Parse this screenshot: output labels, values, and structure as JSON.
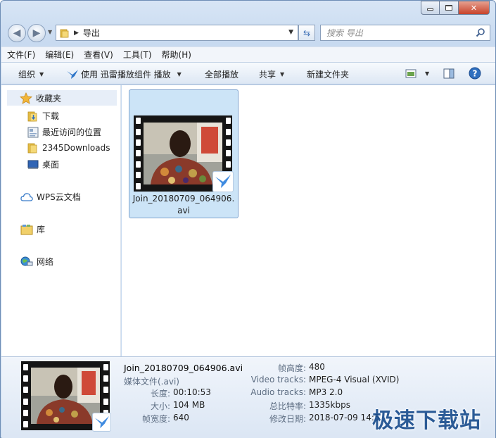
{
  "window": {
    "caption": {
      "minimize": "▭",
      "maximize": "□",
      "close": "✕"
    }
  },
  "address": {
    "crumb": "导出"
  },
  "search": {
    "placeholder": "搜索 导出"
  },
  "menu": [
    "文件(F)",
    "编辑(E)",
    "查看(V)",
    "工具(T)",
    "帮助(H)"
  ],
  "toolbar": {
    "organize": "组织",
    "play_with": "使用 迅雷播放组件 播放",
    "play_all": "全部播放",
    "share": "共享",
    "new_folder": "新建文件夹"
  },
  "sidebar": {
    "favorites": "收藏夹",
    "items": [
      "下载",
      "最近访问的位置",
      "2345Downloads",
      "桌面"
    ],
    "wps": "WPS云文档",
    "libraries": "库",
    "network": "网络"
  },
  "file": {
    "name": "Join_20180709_064906.avi",
    "type": "媒体文件(.avi)"
  },
  "details": {
    "left": [
      {
        "k": "长度:",
        "v": "00:10:53"
      },
      {
        "k": "大小:",
        "v": "104 MB"
      },
      {
        "k": "帧宽度:",
        "v": "640"
      }
    ],
    "right": [
      {
        "k": "帧高度:",
        "v": "480"
      },
      {
        "k": "Video tracks:",
        "v": "MPEG-4 Visual (XVID)"
      },
      {
        "k": "Audio tracks:",
        "v": "MP3 2.0"
      },
      {
        "k": "总比特率:",
        "v": "1335kbps"
      },
      {
        "k": "修改日期:",
        "v": "2018-07-09 14:5"
      }
    ]
  },
  "watermark": "极速下载站",
  "colors": {
    "selection": "#cce4f7",
    "accent": "#3a6eb5"
  }
}
